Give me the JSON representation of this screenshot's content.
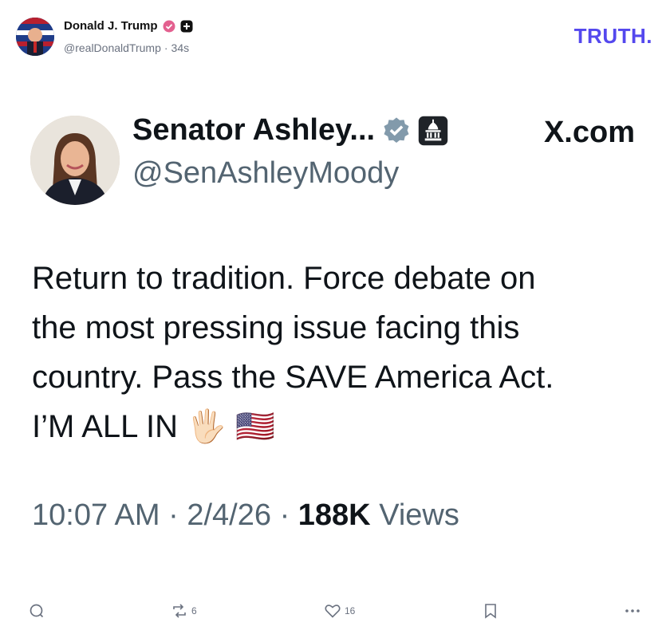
{
  "post": {
    "author_name": "Donald J. Trump",
    "author_handle": "@realDonaldTrump",
    "separator": "·",
    "age": "34s",
    "brand": "TRUTH",
    "brand_dot": ".",
    "brand_color": "#5448ee",
    "verified_badge_icon": "verified-badge-icon",
    "plus_icon": "plus-square-icon"
  },
  "tweet": {
    "display_name": "Senator Ashley...",
    "handle": "@SenAshleyMoody",
    "source": "X.com",
    "verified_icon": "gray-verified-badge-icon",
    "government_icon": "capitol-building-icon",
    "text_lines": [
      "Return to tradition. Force debate on",
      "the most pressing issue facing this",
      "country. Pass the SAVE America Act.",
      "I’M ALL IN"
    ],
    "emoji_hand": "🖐🏻",
    "emoji_flag": "🇺🇸",
    "time": "10:07 AM",
    "date": "2/4/26",
    "views_count": "188K",
    "views_label": "Views",
    "meta_separator": "·"
  },
  "actions": {
    "reply_icon": "reply-icon",
    "retruth_icon": "retruth-icon",
    "retruth_count": "6",
    "like_icon": "heart-icon",
    "like_count": "16",
    "bookmark_icon": "bookmark-icon",
    "more_icon": "more-options-icon"
  }
}
